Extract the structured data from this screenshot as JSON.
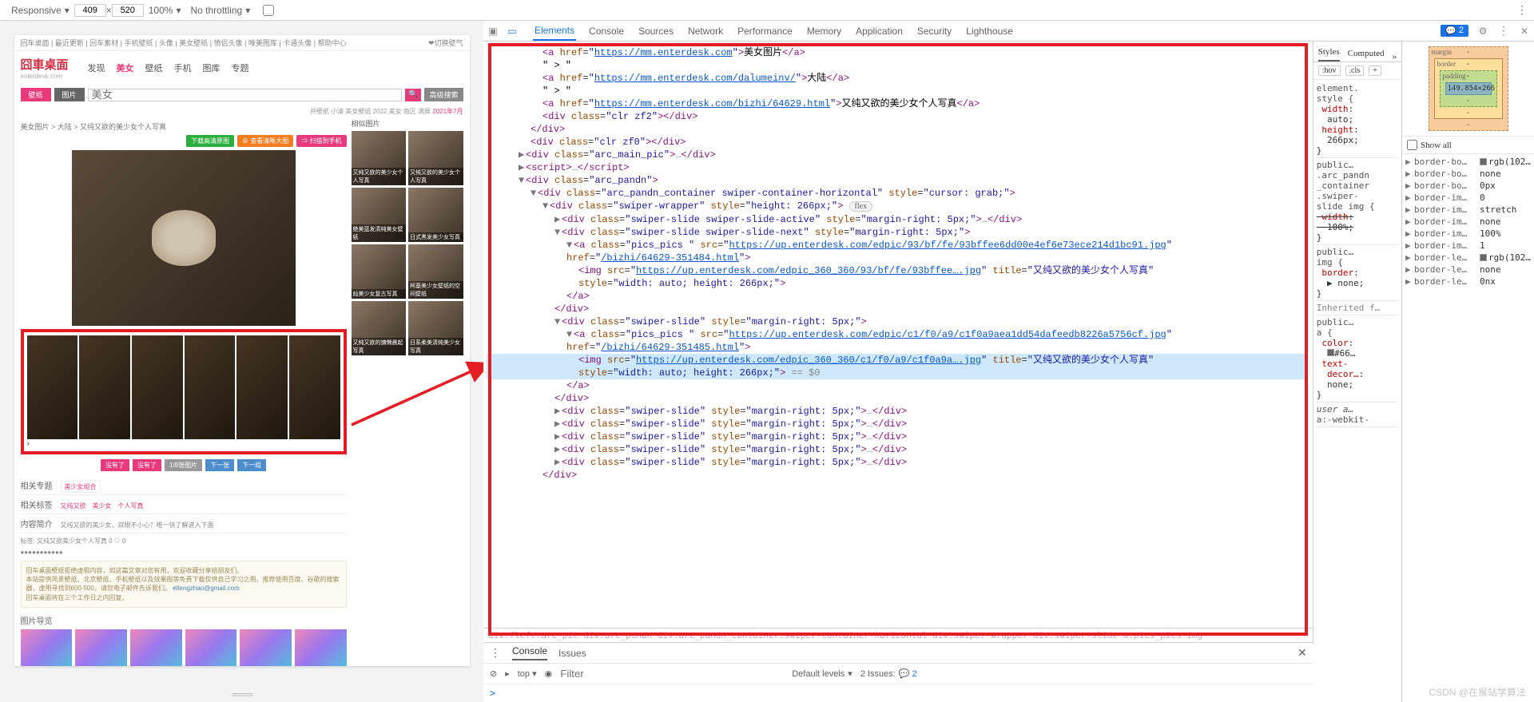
{
  "device_bar": {
    "device": "Responsive",
    "width": "409",
    "height": "520",
    "zoom": "100%",
    "throttling": "No throttling"
  },
  "devtools_tabs": [
    "Elements",
    "Console",
    "Sources",
    "Network",
    "Performance",
    "Memory",
    "Application",
    "Security",
    "Lighthouse"
  ],
  "devtools_active_tab": "Elements",
  "message_count": "2",
  "preview": {
    "header_links": "回车桌面 | 最近更新 | 回车素材 | 手机壁纸 | 头像 | 美女壁纸 | 情侣头像 | 唯美图库 | 卡通头像 | 帮助中心",
    "header_right": "❤切换壁气",
    "logo": "囧車桌面",
    "logo_sub": "enterdesk.com",
    "nav": [
      "发现",
      "美女",
      "壁纸",
      "手机",
      "图库",
      "专题"
    ],
    "nav_active": 1,
    "search_tab1": "壁纸",
    "search_tab2": "图片",
    "search_placeholder": "美女",
    "search_btn2": "高级搜索",
    "meta_line": "共壁纸 小清 美女壁纸 2022 美女 南区 满屏 ",
    "meta_red": "2021年7月",
    "breadcrumb": "美女图片 > 大陆 > 又纯又欲的美少女个人写真",
    "btn_green": "下载高清原图",
    "btn_orange": "⊕ 查看清晰大图",
    "btn_pink": "⇒ 扫描到手机",
    "pager": [
      "没有了",
      "没有了",
      "1/8张图片",
      "下一张",
      "下一组"
    ],
    "sect1": "相关专题",
    "tag1": "美少女组合",
    "sect2": "相关标签",
    "tags2": "又纯又欲　美少女　个人写真",
    "sect3": "内容简介",
    "desc3": "又纯又欲的美少女，双眼不小心？唯一快了解进入下面",
    "rating_line": "标签: 又纯又欲美少女个人写真   0 ♡ 0",
    "footer_note_1": "回车桌面壁纸拒绝虚假内容，如这篇文章对您有用，欢迎收藏分享给朋友们。",
    "footer_note_2": "本站提供风景壁纸、北京壁纸、手机壁纸以及效果图等免费下载仅供自己学习之用，推荐使用百度、谷歌的搜索器，虚用寻找到600-500，请您电子邮件告诉我们。",
    "footer_email": "eitengzhao@gmail.com",
    "footer_note_3": "回车桌面将在三个工作日之内回复。",
    "gallery_title": "图片导览",
    "side_title": "相似图片",
    "side_items": [
      "又纯又欲的美少女个人写真",
      "又纯又欲的美少女个人写真",
      "绝美蓝发清纯美女壁纸",
      "日式黑发美少女写真",
      "灿美少女复古写真",
      "柯基美少女壁纸的空间壁纸",
      "又纯又欲的慵懒晨起写真",
      "日系柔美清纯美少女写真"
    ]
  },
  "elements_breadcrumb": "div.fleft.arc_pic   div.arc_pandn   div.arc_pandn_container.swiper-container-horizontal   div.swiper-wrapper   div.swiper-slide   a.pics_pics   img",
  "dom": {
    "a1_href": "https://mm.enterdesk.com",
    "a1_text": "美女图片",
    "arrow": "\" > \"",
    "a2_href": "https://mm.enterdesk.com/dalumeinv/",
    "a2_text": "大陆",
    "a3_href": "https://mm.enterdesk.com/bizhi/64629.html",
    "a3_text": "又纯又欲的美少女个人写真",
    "div_clr2": "clr zf2",
    "div_clr0": "clr zf0",
    "arc_main_pic": "arc_main_pic",
    "arc_pandn": "arc_pandn",
    "container_class": "arc_pandn_container swiper-container-horizontal",
    "container_style": "cursor: grab;",
    "wrapper_class": "swiper-wrapper",
    "wrapper_style": "height: 266px;",
    "flex_pill": "flex",
    "slide_active": "swiper-slide swiper-slide-active",
    "slide_next": "swiper-slide swiper-slide-next",
    "slide_mr": "margin-right: 5px;",
    "a_pics_class": "pics_pics ",
    "a_pics_src1": "https://up.enterdesk.com/edpic/93/bf/fe/93bffee6dd00e4ef6e73ece214d1bc91.jpg",
    "a_pics_href1": "/bizhi/64629-351484.html",
    "img_src1": "https://up.enterdesk.com/edpic_360_360/93/bf/fe/93bffee….jpg",
    "img_title": "又纯又欲的美少女个人写真",
    "img_style": "width: auto; height: 266px;",
    "a_pics_src2": "https://up.enterdesk.com/edpic/c1/f0/a9/c1f0a9aea1dd54dafeedb8226a5756cf.jpg",
    "a_pics_href2": "/bizhi/64629-351485.html",
    "img_src2": "https://up.enterdesk.com/edpic_360_360/c1/f0/a9/c1f0a9a….jpg",
    "eq0": "== $0",
    "swiper_slide": "swiper-slide"
  },
  "styles": {
    "tab_styles": "Styles",
    "tab_computed": "Computed",
    "hov": ":hov",
    "cls": ".cls",
    "rules": [
      {
        "sel": "element.style {",
        "props": [
          [
            "width",
            "auto;"
          ],
          [
            "height",
            "266px;"
          ]
        ],
        "end": "}"
      },
      {
        "sel": "public…\n.arc_pandn_container .swiper-slide img {",
        "props": [
          [
            "width",
            "100%;",
            true
          ]
        ],
        "end": "}"
      },
      {
        "sel": "public…\nimg {",
        "props": [
          [
            "border",
            "none;"
          ]
        ],
        "end": "}"
      },
      {
        "inherited": "Inherited f…"
      },
      {
        "sel": "public…\na {",
        "props": [
          [
            "color",
            "■#66…"
          ],
          [
            "text-…",
            "…"
          ]
        ],
        "end": "}"
      },
      {
        "sel": "user a…\na:-webkit-"
      }
    ]
  },
  "showall": "Show all",
  "boxmodel": {
    "margin_label": "margin",
    "border_label": "border",
    "padding_label": "padding",
    "content": "149.854×266",
    "dash": "-"
  },
  "computed_props": [
    "border-bo…",
    "border-bo…",
    "border-bo…",
    "border-im…",
    "border-im…",
    "border-im…",
    "border-im…",
    "border-im…",
    "border-le…",
    "border-le…",
    "border-le…"
  ],
  "computed_vals": [
    [
      "swatch",
      "rgb(102…"
    ],
    [
      "",
      "none"
    ],
    [
      "",
      "0px"
    ],
    [
      "",
      "0"
    ],
    [
      "",
      "stretch"
    ],
    [
      "",
      "none"
    ],
    [
      "",
      "100%"
    ],
    [
      "",
      "1"
    ],
    [
      "swatch",
      "rgb(102…"
    ],
    [
      "",
      "none"
    ],
    [
      "",
      "0nx"
    ]
  ],
  "console": {
    "tab_console": "Console",
    "tab_issues": "Issues",
    "top": "top",
    "filter_ph": "Filter",
    "levels": "Default levels",
    "issues_label": "2 Issues:",
    "issues_n": "2",
    "prompt": ">"
  },
  "watermark": "CSDN @在猴站学算法"
}
